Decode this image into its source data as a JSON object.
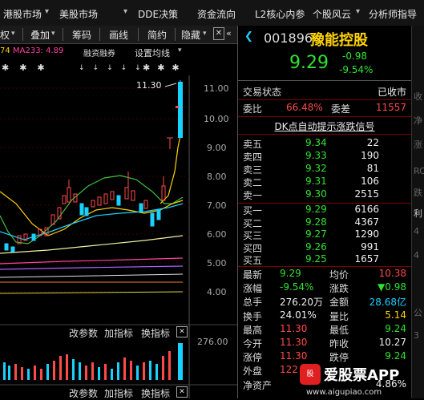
{
  "top_menu": [
    "港股市场",
    "美股市场",
    "DDE决策",
    "资金流向",
    "L2核心内参",
    "个股风云",
    "分析师指导"
  ],
  "toolbar": [
    "权",
    "叠加",
    "筹码",
    "画线",
    "简约",
    "隐藏"
  ],
  "indicator_line": {
    "ma1_suffix": "74",
    "ma233": "MA233: 4.89",
    "margin": "融资融券",
    "ma_setting": "设置均线"
  },
  "chart": {
    "y_axis": [
      "11.00",
      "10.00",
      "9.00",
      "8.00",
      "7.00",
      "6.00",
      "5.00",
      "4.00"
    ],
    "high_label": "11.30",
    "vol_axis": "276.00",
    "panel_buttons": [
      "改参数",
      "加指标",
      "换指标"
    ]
  },
  "quote": {
    "code": "001896",
    "name": "豫能控股",
    "price": "9.29",
    "change": "-0.98",
    "change_pct": "-9.54%",
    "status_label": "交易状态",
    "status_value": "已收市",
    "ratio_label": "委比",
    "ratio_value": "66.48%",
    "diff_label": "委差",
    "diff_value": "11557",
    "dk_hint": "DK点自动提示涨跌信号",
    "sells": [
      {
        "label": "卖五",
        "price": "9.34",
        "vol": "22"
      },
      {
        "label": "卖四",
        "price": "9.33",
        "vol": "190"
      },
      {
        "label": "卖三",
        "price": "9.32",
        "vol": "81"
      },
      {
        "label": "卖二",
        "price": "9.31",
        "vol": "106"
      },
      {
        "label": "卖一",
        "price": "9.30",
        "vol": "2515"
      }
    ],
    "buys": [
      {
        "label": "买一",
        "price": "9.29",
        "vol": "6166"
      },
      {
        "label": "买二",
        "price": "9.28",
        "vol": "4367"
      },
      {
        "label": "买三",
        "price": "9.27",
        "vol": "1290"
      },
      {
        "label": "买四",
        "price": "9.26",
        "vol": "991"
      },
      {
        "label": "买五",
        "price": "9.25",
        "vol": "1657"
      }
    ],
    "stats": [
      {
        "l1": "最新",
        "v1": "9.29",
        "c1": "green",
        "l2": "均价",
        "v2": "10.38",
        "c2": "red"
      },
      {
        "l1": "涨幅",
        "v1": "-9.54%",
        "c1": "green",
        "l2": "涨跌",
        "v2": "▼0.98",
        "c2": "green"
      },
      {
        "l1": "总手",
        "v1": "276.20万",
        "c1": "white",
        "l2": "金额",
        "v2": "28.68亿",
        "c2": "cyan"
      },
      {
        "l1": "换手",
        "v1": "24.01%",
        "c1": "white",
        "l2": "量比",
        "v2": "5.14",
        "c2": "yellow"
      },
      {
        "l1": "最高",
        "v1": "11.30",
        "c1": "red",
        "l2": "最低",
        "v2": "9.24",
        "c2": "green"
      },
      {
        "l1": "今开",
        "v1": "11.30",
        "c1": "red",
        "l2": "昨收",
        "v2": "10.27",
        "c2": "white"
      },
      {
        "l1": "涨停",
        "v1": "11.30",
        "c1": "red",
        "l2": "跌停",
        "v2": "9.24",
        "c2": "green"
      },
      {
        "l1": "外盘",
        "v1": "122",
        "c1": "red",
        "l2": "",
        "v2": "",
        "c2": "white"
      },
      {
        "l1": "净资产",
        "v1": "",
        "c1": "white",
        "l2": "",
        "v2": "4.86%",
        "c2": "white"
      }
    ]
  },
  "watermark": {
    "brand": "爱股票APP",
    "url": "www.aigupiao.com"
  }
}
